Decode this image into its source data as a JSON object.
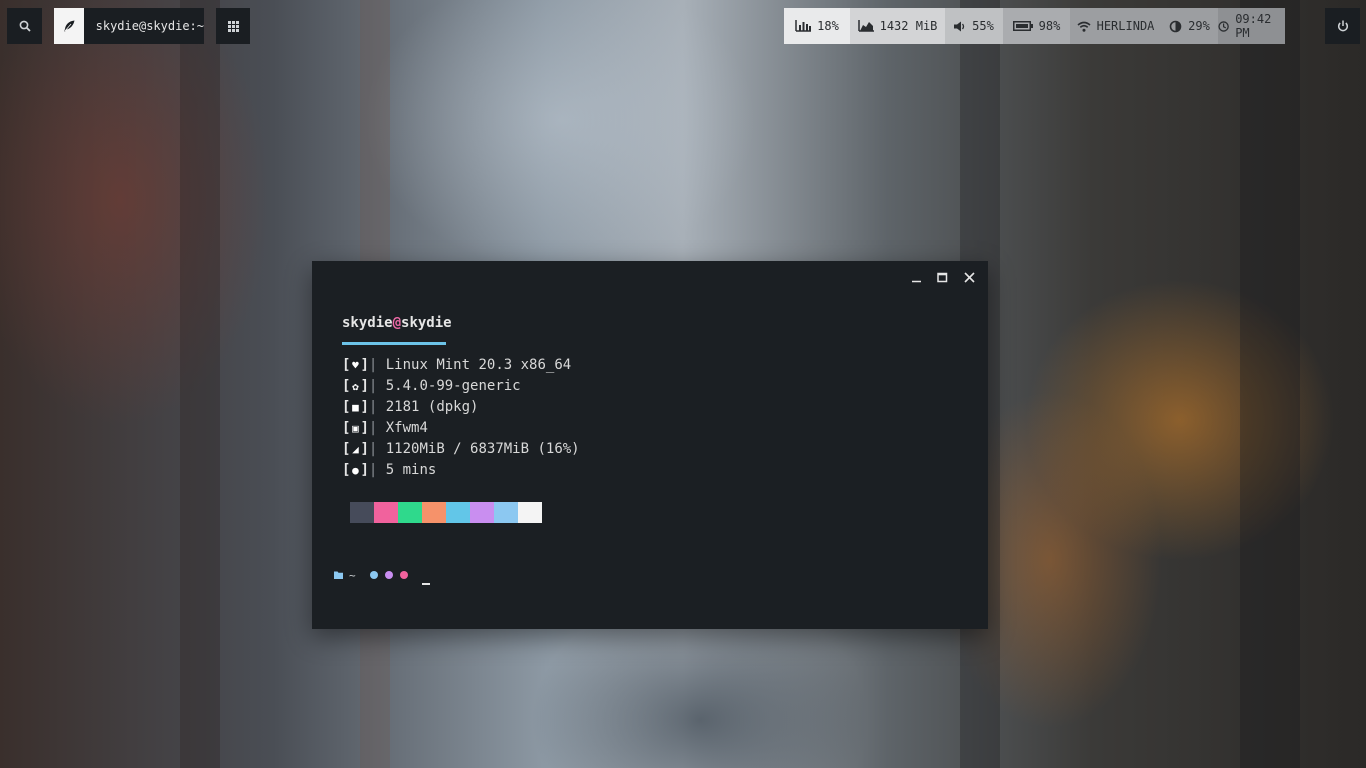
{
  "topbar": {
    "launcher_title": "skydie@skydie:~",
    "status": {
      "cpu": "18%",
      "memory": "1432 MiB",
      "volume": "55%",
      "battery": "98%",
      "network": "HERLINDA",
      "brightness": "29%",
      "clock": "09:42 PM"
    }
  },
  "terminal": {
    "user": "skydie",
    "at": "@",
    "host": "skydie",
    "lines": [
      {
        "icon": "heart-icon",
        "value": "Linux Mint 20.3 x86_64"
      },
      {
        "icon": "gear-icon",
        "value": "5.4.0-99-generic"
      },
      {
        "icon": "package-icon",
        "value": "2181 (dpkg)"
      },
      {
        "icon": "window-icon",
        "value": "Xfwm4"
      },
      {
        "icon": "memory-icon",
        "value": "1120MiB / 6837MiB (16%)"
      },
      {
        "icon": "bulb-icon",
        "value": "5 mins"
      }
    ],
    "palette": [
      "#464b5a",
      "#f1629d",
      "#2fd98c",
      "#f6926a",
      "#62c6e8",
      "#c98ef0",
      "#8cc8f1",
      "#f4f4f4"
    ],
    "prompt": {
      "path": "~",
      "dot_colors": [
        "#8cc8f1",
        "#c98ef0",
        "#f1629d"
      ]
    }
  },
  "colors": {
    "terminal_bg": "#1b1f23",
    "accent_underline": "#6cc3e8",
    "at_sign": "#ee6aa7"
  }
}
